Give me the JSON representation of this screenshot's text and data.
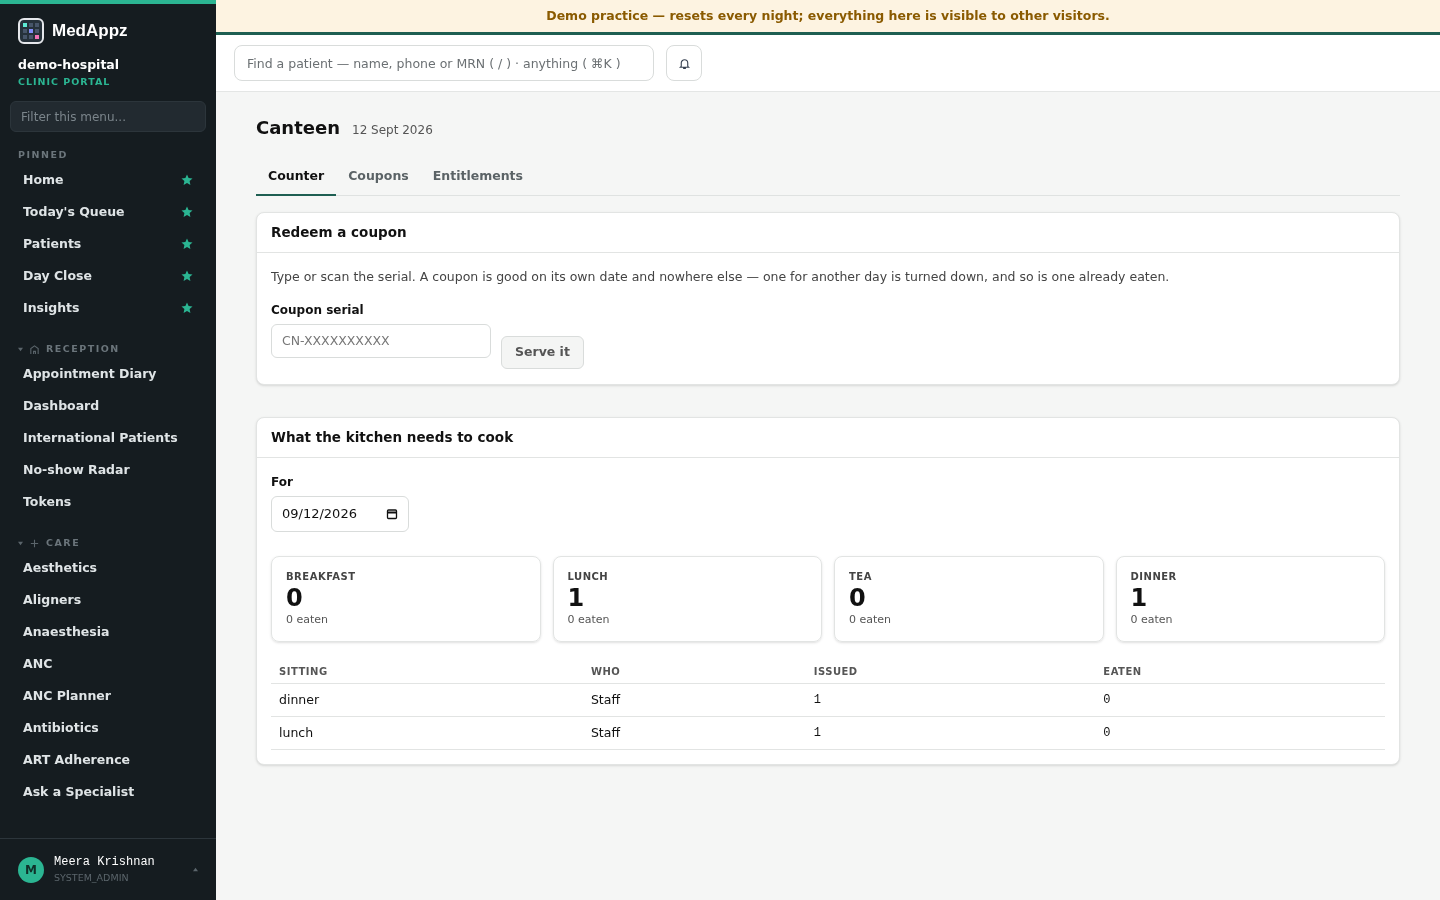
{
  "banner": "Demo practice — resets every night; everything here is visible to other visitors.",
  "sidebar": {
    "brand": "MedAppz",
    "org": "demo-hospital",
    "portal": "CLINIC PORTAL",
    "filter_placeholder": "Filter this menu...",
    "sections": [
      {
        "title": "PINNED",
        "kind": "pinned",
        "items": [
          {
            "label": "Home",
            "pinned": true
          },
          {
            "label": "Today's Queue",
            "pinned": true
          },
          {
            "label": "Patients",
            "pinned": true
          },
          {
            "label": "Day Close",
            "pinned": true
          },
          {
            "label": "Insights",
            "pinned": true
          }
        ]
      },
      {
        "title": "RECEPTION",
        "kind": "reception",
        "expanded": true,
        "items": [
          {
            "label": "Appointment Diary",
            "pinned": false
          },
          {
            "label": "Dashboard",
            "pinned": false
          },
          {
            "label": "International Patients",
            "pinned": false
          },
          {
            "label": "No-show Radar",
            "pinned": false
          },
          {
            "label": "Tokens",
            "pinned": false
          }
        ]
      },
      {
        "title": "CARE",
        "kind": "care",
        "expanded": true,
        "items": [
          {
            "label": "Aesthetics",
            "pinned": false
          },
          {
            "label": "Aligners",
            "pinned": false
          },
          {
            "label": "Anaesthesia",
            "pinned": false
          },
          {
            "label": "ANC",
            "pinned": false
          },
          {
            "label": "ANC Planner",
            "pinned": false
          },
          {
            "label": "Antibiotics",
            "pinned": false
          },
          {
            "label": "ART Adherence",
            "pinned": false
          },
          {
            "label": "Ask a Specialist",
            "pinned": false
          }
        ]
      }
    ],
    "user": {
      "initial": "M",
      "name": "Meera Krishnan",
      "role": "SYSTEM_ADMIN"
    }
  },
  "search": {
    "placeholder": "Find a patient — name, phone or MRN ( / ) · anything ( ⌘K )"
  },
  "page": {
    "title": "Canteen",
    "date": "12 Sept 2026"
  },
  "tabs": [
    {
      "label": "Counter",
      "selected": true
    },
    {
      "label": "Coupons",
      "selected": false
    },
    {
      "label": "Entitlements",
      "selected": false
    }
  ],
  "redeem": {
    "title": "Redeem a coupon",
    "text": "Type or scan the serial. A coupon is good on its own date and nowhere else — one for another day is turned down, and so is one already eaten.",
    "field_label": "Coupon serial",
    "placeholder": "CN-XXXXXXXXXX",
    "button": "Serve it"
  },
  "kitchen": {
    "title": "What the kitchen needs to cook",
    "for_label": "For",
    "date_value": "09/12/2026",
    "meals": [
      {
        "label": "BREAKFAST",
        "count": "0",
        "eaten": "0 eaten"
      },
      {
        "label": "LUNCH",
        "count": "1",
        "eaten": "0 eaten"
      },
      {
        "label": "TEA",
        "count": "0",
        "eaten": "0 eaten"
      },
      {
        "label": "DINNER",
        "count": "1",
        "eaten": "0 eaten"
      }
    ],
    "table": {
      "columns": [
        "SITTING",
        "WHO",
        "ISSUED",
        "EATEN"
      ],
      "rows": [
        [
          "dinner",
          "Staff",
          "1",
          "0"
        ],
        [
          "lunch",
          "Staff",
          "1",
          "0"
        ]
      ]
    }
  }
}
